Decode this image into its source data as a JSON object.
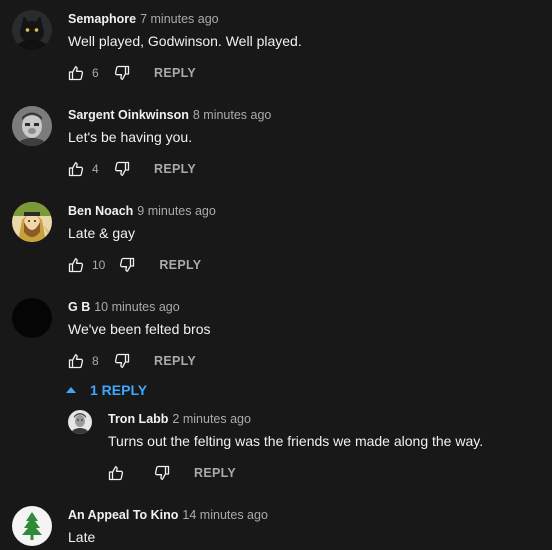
{
  "comments": [
    {
      "author": "Semaphore",
      "time": "7 minutes ago",
      "text": "Well played, Godwinson. Well played.",
      "likes": "6",
      "reply_label": "REPLY"
    },
    {
      "author": "Sargent Oinkwinson",
      "time": "8 minutes ago",
      "text": "Let's be having you.",
      "likes": "4",
      "reply_label": "REPLY"
    },
    {
      "author": "Ben Noach",
      "time": "9 minutes ago",
      "text": "Late & gay",
      "likes": "10",
      "reply_label": "REPLY"
    },
    {
      "author": "G B",
      "time": "10 minutes ago",
      "text": "We've been felted bros",
      "likes": "8",
      "reply_label": "REPLY"
    },
    {
      "author": "An Appeal To Kino",
      "time": "14 minutes ago",
      "text": "Late",
      "likes": "",
      "reply_label": ""
    }
  ],
  "replies_toggle": {
    "label": "1 REPLY"
  },
  "reply": {
    "author": "Tron Labb",
    "time": "2 minutes ago",
    "text": "Turns out the felting was the friends we made along the way.",
    "likes": "",
    "reply_label": "REPLY"
  },
  "icons": {
    "like": "thumbs-up-icon",
    "dislike": "thumbs-down-icon",
    "caret": "caret-up-icon"
  },
  "colors": {
    "background": "#181818",
    "text": "#f1f1f1",
    "muted": "#aaaaaa",
    "accent": "#3ea6ff"
  }
}
